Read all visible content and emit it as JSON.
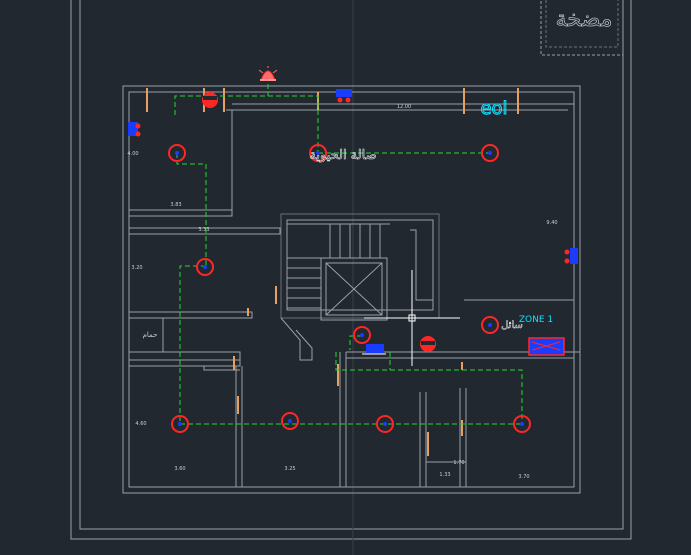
{
  "viewport": {
    "background": "#212830"
  },
  "title_block": {
    "text": "مضخة"
  },
  "labels": {
    "hall": "صالة الحيوية",
    "top_right": "eol",
    "zone": "ZONE 1",
    "sprinkler_lower": "سائل"
  },
  "dimensions": {
    "top_width": "12.00",
    "right_height": "9.40",
    "left_height": "4.00",
    "room_width_1": "3.83",
    "room_width_2": "3.33",
    "room_height_2": "3.20",
    "bottom_left_height": "4.60",
    "bottom_w1": "3.60",
    "bottom_w2": "3.25",
    "bottom_w3": "1.33",
    "bottom_w4": "3.70",
    "bottom_h_small": "1.70",
    "small_room": "حمام"
  },
  "colors": {
    "wall": "#9aa0a6",
    "wall_dark": "#6b7076",
    "pipe": "#27d62b",
    "sprinkler": "#ff2626",
    "blue": "#1a3cff",
    "cyan": "#10e0ff",
    "orange": "#e8a060",
    "crosshair": "#ffffff"
  },
  "icons": {
    "alarm": "fire-alarm-bell-icon",
    "pump": "pump-icon",
    "valve": "valve-icon",
    "panel": "zone-panel-icon"
  }
}
